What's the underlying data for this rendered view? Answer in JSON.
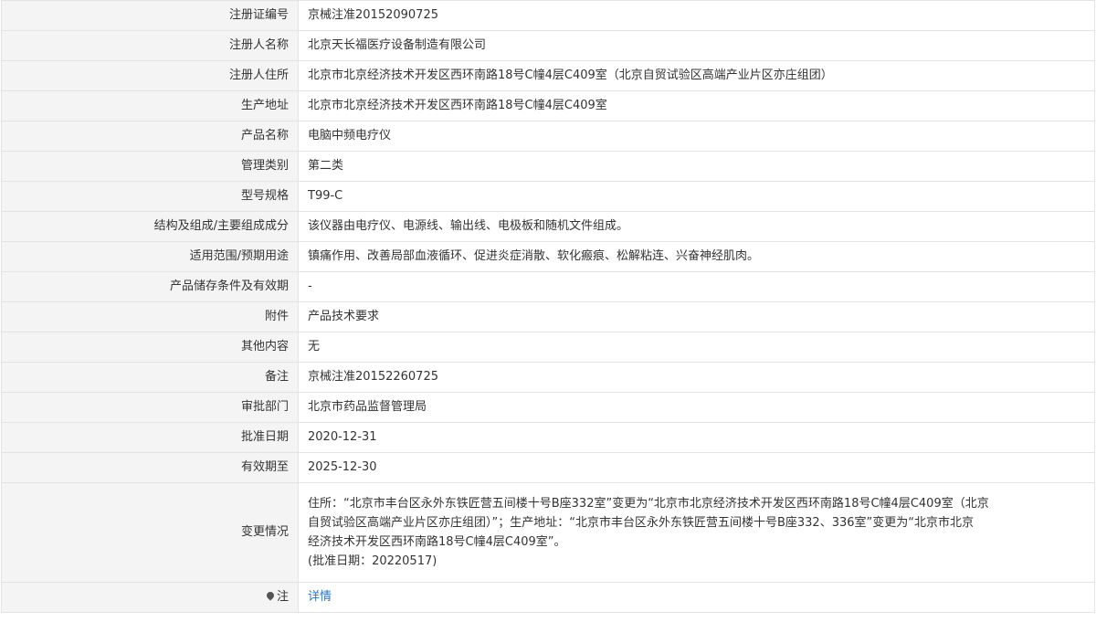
{
  "rows": [
    {
      "label": "注册证编号",
      "value": "京械注准20152090725"
    },
    {
      "label": "注册人名称",
      "value": "北京天长福医疗设备制造有限公司"
    },
    {
      "label": "注册人住所",
      "value": "北京市北京经济技术开发区西环南路18号C幢4层C409室（北京自贸试验区高端产业片区亦庄组团）"
    },
    {
      "label": "生产地址",
      "value": "北京市北京经济技术开发区西环南路18号C幢4层C409室"
    },
    {
      "label": "产品名称",
      "value": "电脑中频电疗仪"
    },
    {
      "label": "管理类别",
      "value": "第二类"
    },
    {
      "label": "型号规格",
      "value": "T99-C"
    },
    {
      "label": "结构及组成/主要组成成分",
      "value": "该仪器由电疗仪、电源线、输出线、电极板和随机文件组成。"
    },
    {
      "label": "适用范围/预期用途",
      "value": "镇痛作用、改善局部血液循环、促进炎症消散、软化瘢痕、松解粘连、兴奋神经肌肉。"
    },
    {
      "label": "产品储存条件及有效期",
      "value": "-"
    },
    {
      "label": "附件",
      "value": "产品技术要求"
    },
    {
      "label": "其他内容",
      "value": "无"
    },
    {
      "label": "备注",
      "value": "京械注准20152260725"
    },
    {
      "label": "审批部门",
      "value": "北京市药品监督管理局"
    },
    {
      "label": "批准日期",
      "value": "2020-12-31"
    },
    {
      "label": "有效期至",
      "value": "2025-12-30"
    }
  ],
  "change": {
    "label": "变更情况",
    "lines": [
      "住所：“北京市丰台区永外东铁匠营五间楼十号B座332室”变更为“北京市北京经济技术开发区西环南路18号C幢4层C409室（北京",
      "自贸试验区高端产业片区亦庄组团）”；生产地址：“北京市丰台区永外东铁匠营五间楼十号B座332、336室”变更为“北京市北京",
      "经济技术开发区西环南路18号C幢4层C409室”。",
      "(批准日期：20220517)"
    ]
  },
  "note": {
    "icon": "pin-icon",
    "label": "注",
    "link_text": "详情"
  }
}
